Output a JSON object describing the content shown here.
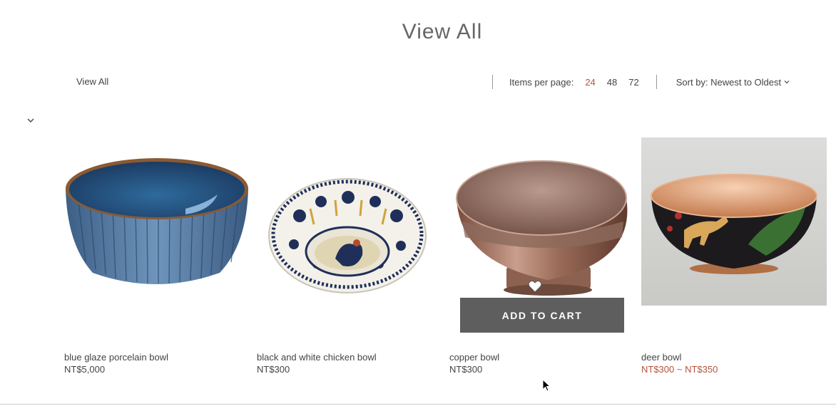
{
  "page": {
    "title": "View All"
  },
  "breadcrumb": {
    "label": "View All"
  },
  "toolbar": {
    "items_per_page_label": "Items per page:",
    "items_per_page_options": [
      "24",
      "48",
      "72"
    ],
    "items_per_page_selected": "24",
    "sort_label": "Sort by: Newest to Oldest"
  },
  "products": [
    {
      "name": "blue glaze porcelain bowl",
      "price": "NT$5,000"
    },
    {
      "name": "black and white chicken bowl",
      "price": "NT$300"
    },
    {
      "name": "copper bowl",
      "price": "NT$300"
    },
    {
      "name": "deer bowl",
      "price": "NT$300 ~ NT$350"
    }
  ],
  "hover_card": {
    "add_to_cart_label": "ADD TO CART"
  },
  "colors": {
    "accent": "#b3543a",
    "button_bg": "#5e5e5e"
  },
  "icons": {
    "filter_toggle": "chevron-down-icon",
    "wishlist": "heart-icon",
    "sort": "chevron-down-icon"
  }
}
